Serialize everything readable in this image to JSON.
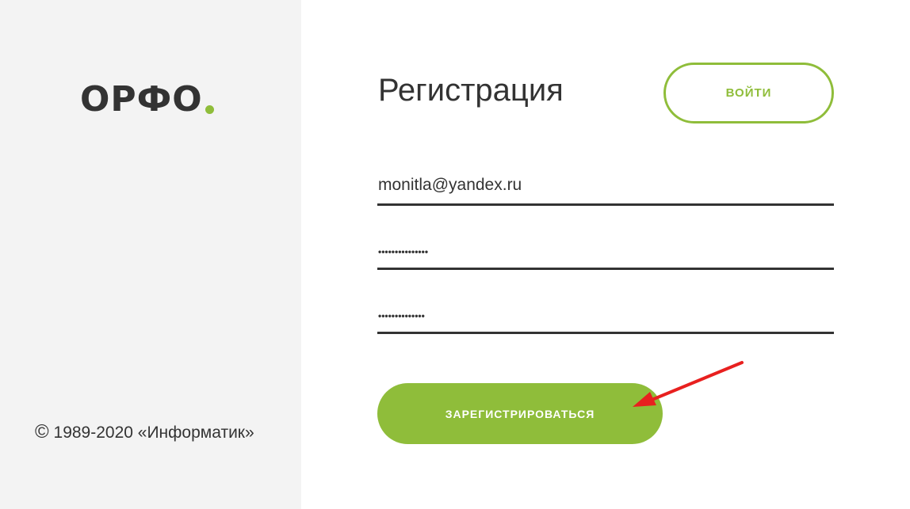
{
  "sidebar": {
    "logo_text": "ОРФО",
    "copyright_sign": "©",
    "copyright_text": " 1989-2020 «Информатик»"
  },
  "form": {
    "title": "Регистрация",
    "login_label": "ВОЙТИ",
    "email_value": "monitla@yandex.ru",
    "password_value": "•••••••••••••••",
    "password_confirm_value": "••••••••••••••",
    "register_label": "ЗАРЕГИСТРИРОВАТЬСЯ"
  },
  "colors": {
    "accent": "#8fbd3a",
    "text": "#333333",
    "sidebar_bg": "#f3f3f3",
    "annotation_arrow": "#e8201f"
  },
  "icons": {
    "annotation": "arrow-icon"
  }
}
